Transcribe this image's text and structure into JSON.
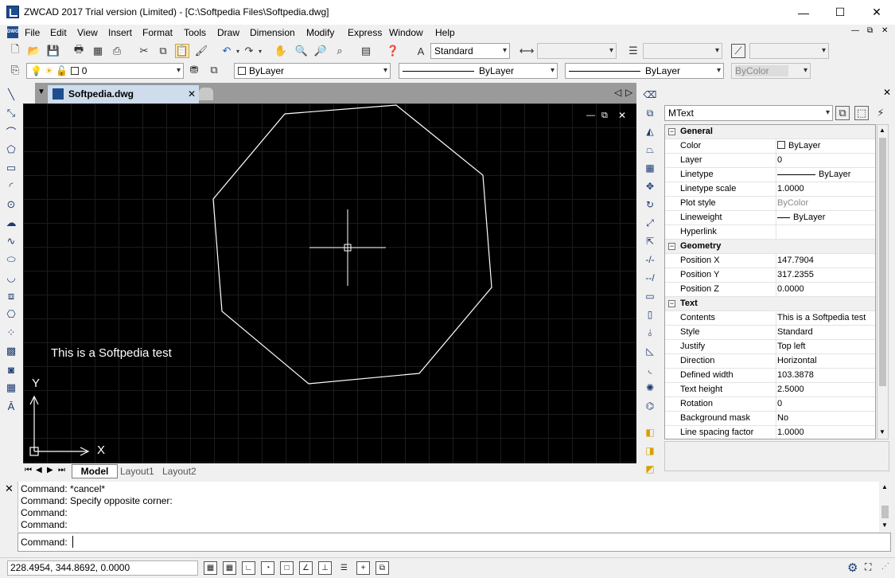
{
  "window": {
    "title": "ZWCAD 2017 Trial version (Limited) - [C:\\Softpedia Files\\Softpedia.dwg]",
    "minimize": "—",
    "maximize": "☐",
    "close": "✕"
  },
  "menu": {
    "doc_icon": "DWG",
    "items": [
      "File",
      "Edit",
      "View",
      "Insert",
      "Format",
      "Tools",
      "Draw",
      "Dimension",
      "Modify",
      "Express",
      "Window",
      "Help"
    ],
    "mdi_minimize": "—",
    "mdi_restore": "⧉",
    "mdi_close": "✕"
  },
  "toolbar": {
    "text_style": "Standard",
    "layer": "0",
    "color": "ByLayer",
    "linetype": "ByLayer",
    "lineweight": "ByLayer",
    "plotstyle": "ByColor"
  },
  "document_tab": {
    "label": "Softpedia.dwg",
    "close": "✕"
  },
  "drawing": {
    "text_object": "This is a Softpedia test",
    "axis_x": "X",
    "axis_y": "Y",
    "vp_min": "—",
    "vp_restore": "⧉",
    "vp_close": "✕"
  },
  "layout_tabs": [
    "Model",
    "Layout1",
    "Layout2"
  ],
  "properties": {
    "object_type": "MText",
    "categories": {
      "general": "General",
      "geometry": "Geometry",
      "text": "Text"
    },
    "general": [
      {
        "label": "Color",
        "value": "ByLayer"
      },
      {
        "label": "Layer",
        "value": "0"
      },
      {
        "label": "Linetype",
        "value": "ByLayer"
      },
      {
        "label": "Linetype scale",
        "value": "1.0000"
      },
      {
        "label": "Plot style",
        "value": "ByColor"
      },
      {
        "label": "Lineweight",
        "value": "ByLayer"
      },
      {
        "label": "Hyperlink",
        "value": ""
      }
    ],
    "geometry": [
      {
        "label": "Position X",
        "value": "147.7904"
      },
      {
        "label": "Position Y",
        "value": "317.2355"
      },
      {
        "label": "Position Z",
        "value": "0.0000"
      }
    ],
    "text": [
      {
        "label": "Contents",
        "value": "This is a Softpedia test"
      },
      {
        "label": "Style",
        "value": "Standard"
      },
      {
        "label": "Justify",
        "value": "Top left"
      },
      {
        "label": "Direction",
        "value": "Horizontal"
      },
      {
        "label": "Defined width",
        "value": "103.3878"
      },
      {
        "label": "Text height",
        "value": "2.5000"
      },
      {
        "label": "Rotation",
        "value": "0"
      },
      {
        "label": "Background mask",
        "value": "No"
      },
      {
        "label": "Line spacing factor",
        "value": "1.0000"
      }
    ]
  },
  "command": {
    "history": [
      "Command: *cancel*",
      "Command: Specify opposite corner:",
      "Command:",
      "Command:"
    ],
    "prompt": "Command:",
    "close": "✕"
  },
  "status": {
    "coordinates": "228.4954, 344.8692, 0.0000"
  }
}
